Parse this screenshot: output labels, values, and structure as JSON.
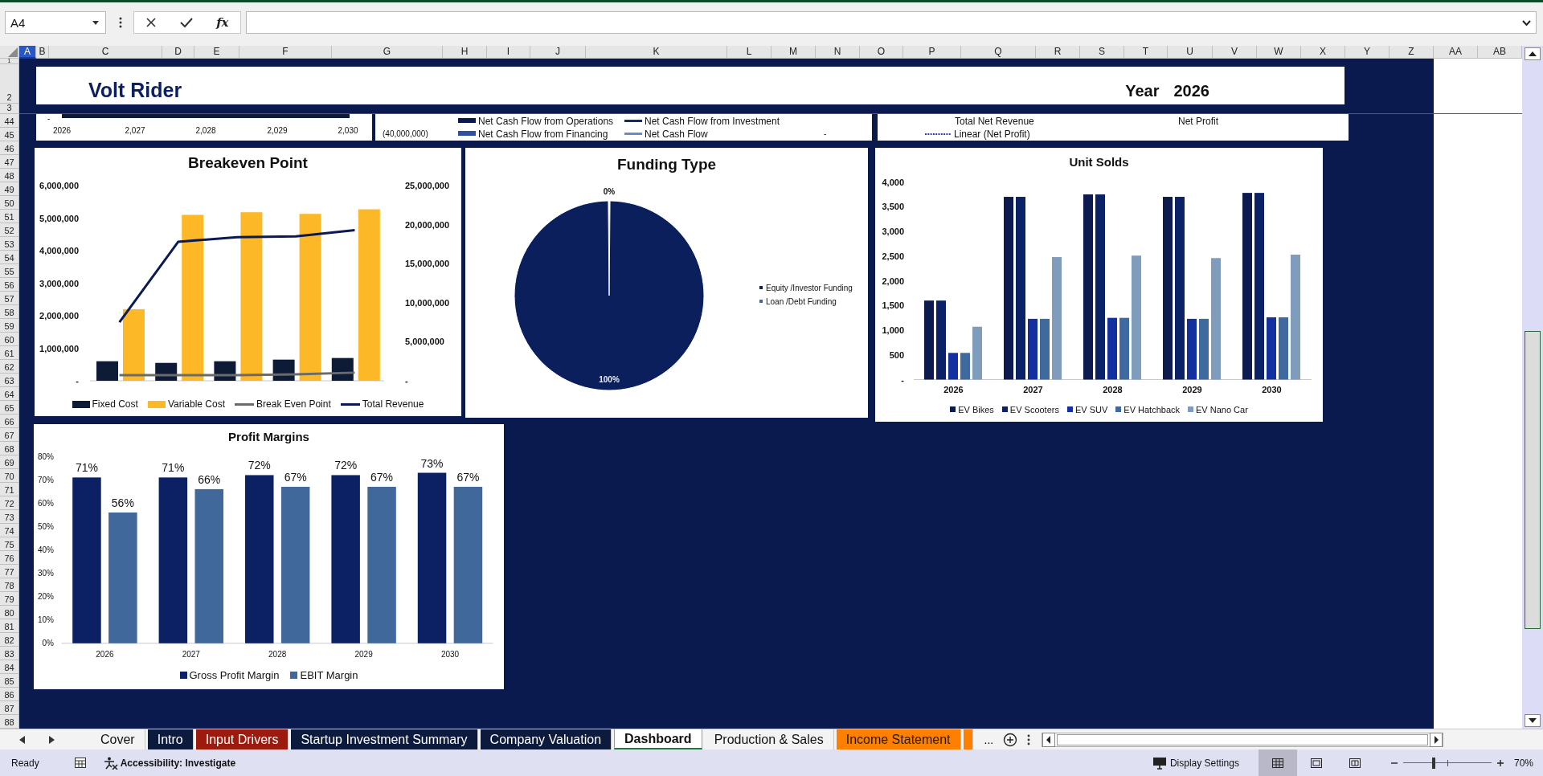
{
  "formula_bar": {
    "name_box": "A4",
    "function_label": "fx"
  },
  "columns": [
    {
      "label": "A",
      "selected": true
    },
    {
      "label": "B",
      "selected": false
    },
    {
      "label": "C",
      "selected": false
    },
    {
      "label": "D",
      "selected": false
    },
    {
      "label": "E",
      "selected": false
    },
    {
      "label": "F",
      "selected": false
    },
    {
      "label": "G",
      "selected": false
    },
    {
      "label": "H",
      "selected": false
    },
    {
      "label": "I",
      "selected": false
    },
    {
      "label": "J",
      "selected": false
    },
    {
      "label": "K",
      "selected": false
    },
    {
      "label": "L",
      "selected": false
    },
    {
      "label": "M",
      "selected": false
    },
    {
      "label": "N",
      "selected": false
    },
    {
      "label": "O",
      "selected": false
    },
    {
      "label": "P",
      "selected": false
    },
    {
      "label": "Q",
      "selected": false
    },
    {
      "label": "R",
      "selected": false
    },
    {
      "label": "S",
      "selected": false
    },
    {
      "label": "T",
      "selected": false
    },
    {
      "label": "U",
      "selected": false
    },
    {
      "label": "V",
      "selected": false
    },
    {
      "label": "W",
      "selected": false
    },
    {
      "label": "X",
      "selected": false
    },
    {
      "label": "Y",
      "selected": false
    },
    {
      "label": "Z",
      "selected": false
    },
    {
      "label": "AA",
      "selected": false
    },
    {
      "label": "AB",
      "selected": false
    }
  ],
  "rows": [
    "1",
    "2",
    "3",
    "44",
    "45",
    "46",
    "47",
    "48",
    "49",
    "50",
    "51",
    "52",
    "53",
    "54",
    "55",
    "56",
    "57",
    "58",
    "59",
    "60",
    "61",
    "62",
    "63",
    "64",
    "65",
    "66",
    "67",
    "68",
    "69",
    "70",
    "71",
    "72",
    "73",
    "74",
    "75",
    "76",
    "77",
    "78",
    "79",
    "80",
    "81",
    "82",
    "83",
    "84",
    "85",
    "86",
    "87",
    "88"
  ],
  "banner": {
    "title": "Volt Rider",
    "year_label": "Year",
    "year": "2026"
  },
  "partial_chart_left": {
    "axis_label": "-",
    "x_labels": [
      "2026",
      "2,027",
      "2,028",
      "2,029",
      "2,030"
    ]
  },
  "partial_chart_middle": {
    "axis_labels": [
      "(40,000,000)",
      "-"
    ],
    "legend": [
      {
        "name": "Net Cash Flow from Operations",
        "kind": "bar",
        "color": "#0b1a4a"
      },
      {
        "name": "Net Cash Flow from Investment",
        "kind": "line",
        "color": "#142a6e"
      },
      {
        "name": "Net Cash Flow from Financing",
        "kind": "bar",
        "color": "#2f4f9f"
      },
      {
        "name": "Net Cash Flow",
        "kind": "line",
        "color": "#6a8ad0"
      }
    ]
  },
  "partial_chart_right": {
    "legend": [
      {
        "name": "Total Net Revenue",
        "kind": "none"
      },
      {
        "name": "Net Profit",
        "kind": "none"
      },
      {
        "name": "Linear (Net Profit)",
        "kind": "dotted",
        "color": "#2a3fa8"
      }
    ]
  },
  "breakeven_chart": {
    "chart_data": {
      "type": "bar",
      "title": "Breakeven Point",
      "stacked": false,
      "legend": "bottom",
      "series": [
        {
          "name": "Fixed Cost",
          "type": "bar",
          "color": "#0d1b36",
          "values": [
            600000,
            550000,
            600000,
            650000,
            700000
          ]
        },
        {
          "name": "Variable Cost",
          "type": "bar",
          "color": "#fdb827",
          "values": [
            2200000,
            5100000,
            5180000,
            5130000,
            5270000
          ]
        },
        {
          "name": "Break Even Point",
          "type": "line",
          "color": "#6b6b6b",
          "values": [
            170000,
            170000,
            170000,
            200000,
            250000
          ]
        },
        {
          "name": "Total Revenue",
          "type": "line",
          "axis": "y2",
          "color": "#0b1a52",
          "values": [
            7500000,
            17800000,
            18400000,
            18500000,
            19300000
          ]
        }
      ],
      "ylim": [
        0,
        6000000
      ],
      "yticks": [
        {
          "value": 0,
          "label": "-"
        },
        {
          "value": 1000000,
          "label": "1,000,000"
        },
        {
          "value": 2000000,
          "label": "2,000,000"
        },
        {
          "value": 3000000,
          "label": "3,000,000"
        },
        {
          "value": 4000000,
          "label": "4,000,000"
        },
        {
          "value": 5000000,
          "label": "5,000,000"
        },
        {
          "value": 6000000,
          "label": "6,000,000"
        }
      ],
      "y2lim": [
        0,
        25000000
      ],
      "y2ticks": [
        {
          "value": 0,
          "label": "-"
        },
        {
          "value": 5000000,
          "label": "5,000,000"
        },
        {
          "value": 10000000,
          "label": "10,000,000"
        },
        {
          "value": 15000000,
          "label": "15,000,000"
        },
        {
          "value": 20000000,
          "label": "20,000,000"
        },
        {
          "value": 25000000,
          "label": "25,000,000"
        }
      ]
    }
  },
  "funding_chart": {
    "chart_data": {
      "type": "pie",
      "title": "Funding Type",
      "legend": "right",
      "categories": [
        "Equity /Investor Funding",
        "Loan /Debt Funding"
      ],
      "values": [
        100,
        0
      ],
      "colors": [
        "#0a1f5c",
        "#41699e"
      ],
      "value_labels": [
        "100%",
        "0%"
      ]
    }
  },
  "units_chart": {
    "chart_data": {
      "type": "bar",
      "title": "Unit Solds",
      "legend": "bottom",
      "categories": [
        "2026",
        "2027",
        "2028",
        "2029",
        "2030"
      ],
      "series": [
        {
          "name": "EV Bikes",
          "color": "#0d1a4f",
          "values": [
            1600,
            3700,
            3750,
            3700,
            3780
          ]
        },
        {
          "name": "EV Scooters",
          "color": "#0b2266",
          "values": [
            1600,
            3700,
            3750,
            3700,
            3780
          ]
        },
        {
          "name": "EV SUV",
          "color": "#1430a0",
          "values": [
            540,
            1230,
            1250,
            1230,
            1260
          ]
        },
        {
          "name": "EV Hatchback",
          "color": "#3e6aa0",
          "values": [
            540,
            1230,
            1250,
            1230,
            1260
          ]
        },
        {
          "name": "EV Nano Car",
          "color": "#7f9cbd",
          "values": [
            1070,
            2480,
            2510,
            2460,
            2530
          ]
        }
      ],
      "ylim": [
        0,
        4000
      ],
      "yticks": [
        {
          "value": 0,
          "label": "-"
        },
        {
          "value": 500,
          "label": "500"
        },
        {
          "value": 1000,
          "label": "1,000"
        },
        {
          "value": 1500,
          "label": "1,500"
        },
        {
          "value": 2000,
          "label": "2,000"
        },
        {
          "value": 2500,
          "label": "2,500"
        },
        {
          "value": 3000,
          "label": "3,000"
        },
        {
          "value": 3500,
          "label": "3,500"
        },
        {
          "value": 4000,
          "label": "4,000"
        }
      ]
    }
  },
  "margins_chart": {
    "chart_data": {
      "type": "bar",
      "title": "Profit Margins",
      "legend": "bottom",
      "categories": [
        "2026",
        "2027",
        "2028",
        "2029",
        "2030"
      ],
      "series": [
        {
          "name": "Gross Profit Margin",
          "color": "#0b2163",
          "values": [
            71,
            71,
            72,
            72,
            73
          ]
        },
        {
          "name": "EBIT Margin",
          "color": "#41689b",
          "values": [
            56,
            66,
            67,
            67,
            67
          ]
        }
      ],
      "ylim": [
        0,
        80
      ],
      "yticks": [
        {
          "value": 0,
          "label": "0%"
        },
        {
          "value": 10,
          "label": "10%"
        },
        {
          "value": 20,
          "label": "20%"
        },
        {
          "value": 30,
          "label": "30%"
        },
        {
          "value": 40,
          "label": "40%"
        },
        {
          "value": 50,
          "label": "50%"
        },
        {
          "value": 60,
          "label": "60%"
        },
        {
          "value": 70,
          "label": "70%"
        },
        {
          "value": 80,
          "label": "80%"
        }
      ],
      "value_labels": [
        [
          "71%",
          "71%",
          "72%",
          "72%",
          "73%"
        ],
        [
          "56%",
          "66%",
          "67%",
          "67%",
          "67%"
        ]
      ]
    }
  },
  "sheet_tabs": [
    {
      "label": "Cover",
      "selected": false
    },
    {
      "label": "Intro",
      "selected": false,
      "color": "#0b1a3d"
    },
    {
      "label": "Input Drivers",
      "selected": false,
      "color": "#9c1b0e"
    },
    {
      "label": "Startup Investment Summary",
      "selected": false,
      "color": "#0b1a3d"
    },
    {
      "label": "Company Valuation",
      "selected": false,
      "color": "#0b1a3d"
    },
    {
      "label": "Dashboard",
      "selected": true
    },
    {
      "label": "Production & Sales",
      "selected": false
    },
    {
      "label": "Income Statement",
      "selected": false,
      "color": "#ff8000"
    },
    {
      "selected": false,
      "color": "#ff8000"
    }
  ],
  "tab_overflow": "...",
  "status_bar": {
    "mode": "Ready",
    "accessibility": "Accessibility: Investigate",
    "display_settings": "Display Settings",
    "views": [
      {
        "kind": "normal",
        "selected": true
      },
      {
        "kind": "page_layout",
        "selected": false
      },
      {
        "kind": "page_break",
        "selected": false
      }
    ],
    "zoom": {
      "level": 0.35,
      "label": "70%"
    }
  }
}
